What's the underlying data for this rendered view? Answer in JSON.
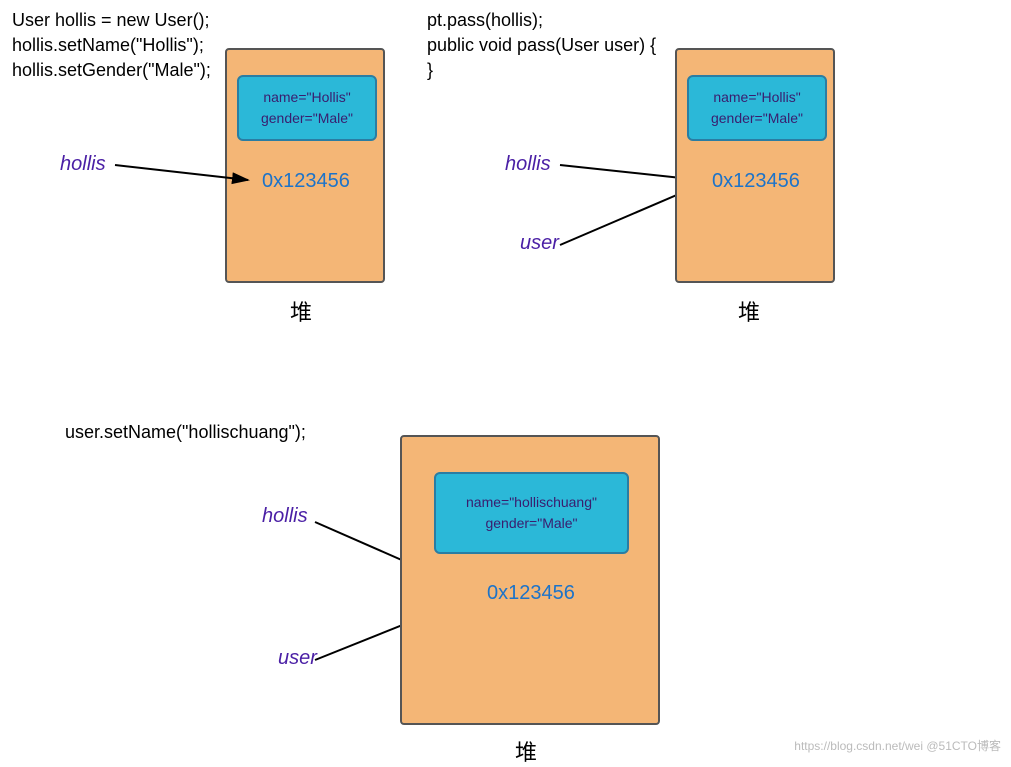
{
  "panel1": {
    "code": "User hollis = new User();\nhollis.setName(\"Hollis\");\nhollis.setGender(\"Male\");",
    "var1": "hollis",
    "obj_line1": "name=\"Hollis\"",
    "obj_line2": "gender=\"Male\"",
    "addr": "0x123456",
    "heap_label": "堆"
  },
  "panel2": {
    "code": "pt.pass(hollis);\npublic void pass(User user) {\n}",
    "var1": "hollis",
    "var2": "user",
    "obj_line1": "name=\"Hollis\"",
    "obj_line2": "gender=\"Male\"",
    "addr": "0x123456",
    "heap_label": "堆"
  },
  "panel3": {
    "code": "user.setName(\"hollischuang\");",
    "var1": "hollis",
    "var2": "user",
    "obj_line1": "name=\"hollischuang\"",
    "obj_line2": "gender=\"Male\"",
    "addr": "0x123456",
    "heap_label": "堆"
  },
  "watermark": "https://blog.csdn.net/wei @51CTO博客"
}
